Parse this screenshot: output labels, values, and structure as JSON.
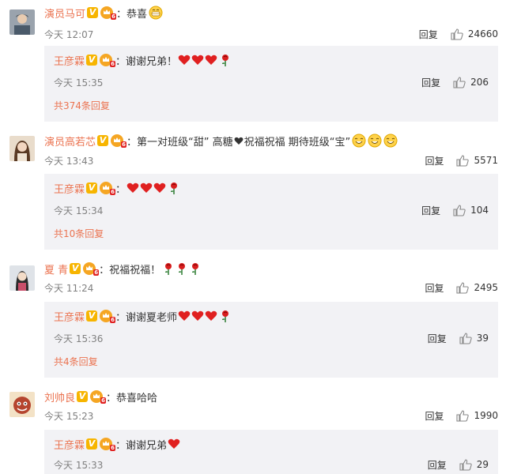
{
  "comments": [
    {
      "user": "演员马可",
      "text": "：恭喜",
      "time": "今天 12:07",
      "reply_label": "回复",
      "likes": "24660",
      "sub": {
        "user": "王彦霖",
        "text": "：谢谢兄弟！",
        "time": "今天 15:35",
        "reply_label": "回复",
        "likes": "206"
      },
      "expand": "共374条回复"
    },
    {
      "user": "演员高若芯",
      "text_a": "：第一对班级“甜” 高糖",
      "text_b": "祝福祝福 期待班级“宝”",
      "time": "今天 13:43",
      "reply_label": "回复",
      "likes": "5571",
      "sub": {
        "user": "王彦霖",
        "text": "：",
        "time": "今天 15:34",
        "reply_label": "回复",
        "likes": "104"
      },
      "expand": "共10条回复"
    },
    {
      "user": "夏 青",
      "text": "：祝福祝福！",
      "time": "今天 11:24",
      "reply_label": "回复",
      "likes": "2495",
      "sub": {
        "user": "王彦霖",
        "text": "：谢谢夏老师",
        "time": "今天 15:36",
        "reply_label": "回复",
        "likes": "39"
      },
      "expand": "共4条回复"
    },
    {
      "user": "刘帅良",
      "text": "：恭喜哈哈",
      "time": "今天 15:23",
      "reply_label": "回复",
      "likes": "1990",
      "sub": {
        "user": "王彦霖",
        "text": "：谢谢兄弟",
        "time": "今天 15:33",
        "reply_label": "回复",
        "likes": "29"
      }
    }
  ],
  "badges": {
    "verified": "V",
    "vip_level": "6"
  },
  "icons": [
    "thumbs-up-icon",
    "heart-emoji-icon",
    "rose-emoji-icon",
    "grin-emoji-icon",
    "smile-emoji-icon",
    "verified-v-icon",
    "vip-crown-icon"
  ],
  "colors": {
    "username": "#eb7350",
    "sub_bg": "#f2f2f5",
    "meta": "#808080",
    "heart": "#e02020",
    "verified": "#f7b500"
  }
}
